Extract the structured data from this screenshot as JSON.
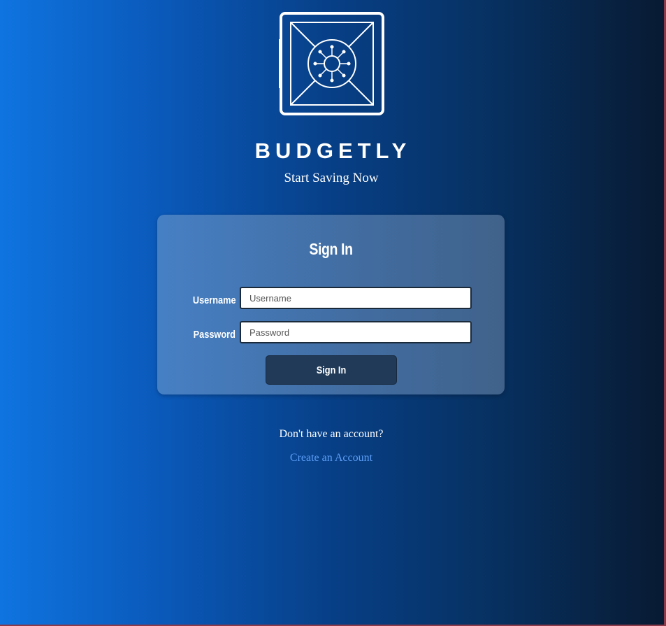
{
  "brand": {
    "logo_icon": "vault-safe-icon",
    "title": "BUDGETLY",
    "tagline": "Start Saving Now"
  },
  "signin_card": {
    "title": "Sign In",
    "username_label": "Username",
    "username_placeholder": "Username",
    "username_value": "",
    "password_label": "Password",
    "password_placeholder": "Password",
    "password_value": "",
    "submit_label": "Sign In"
  },
  "footer": {
    "prompt": "Don't have an account?",
    "create_link": "Create an Account"
  },
  "colors": {
    "gradient_left": "#0f74e0",
    "gradient_right": "#081a32",
    "button_bg": "#203a58",
    "link": "#5b9cf5"
  }
}
